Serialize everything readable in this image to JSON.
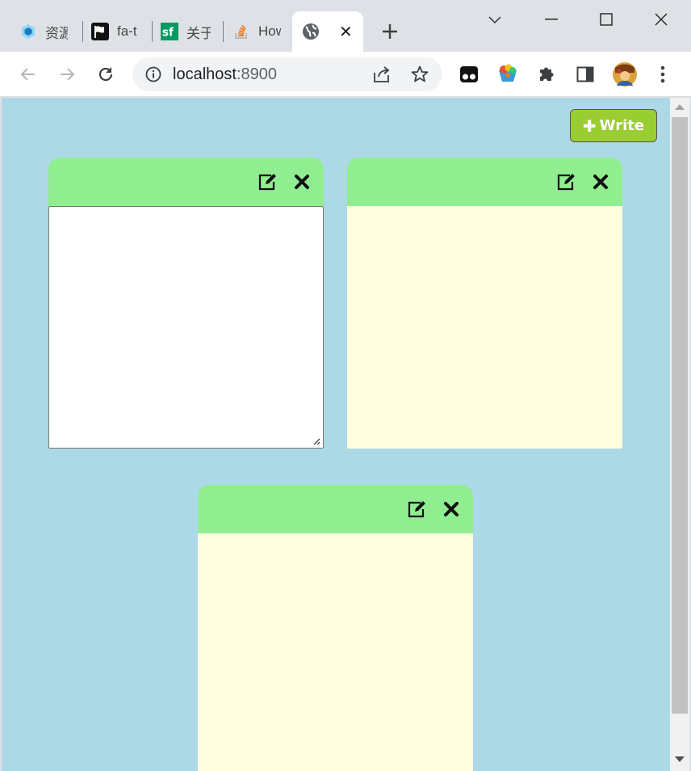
{
  "browser": {
    "tabs": [
      {
        "label": "资源",
        "icon": "webpack-cube-icon"
      },
      {
        "label": "fa-t",
        "icon": "flag-icon"
      },
      {
        "label": "关于",
        "icon": "sf-logo-icon"
      },
      {
        "label": "How",
        "icon": "stackoverflow-icon"
      },
      {
        "label": "",
        "icon": "globe-icon",
        "active": true
      }
    ],
    "address": {
      "host": "localhost",
      "port": ":8900"
    }
  },
  "page": {
    "write_button": {
      "label": "Write",
      "icon": "plus-icon",
      "color": "#9acd32"
    },
    "colors": {
      "background": "#add8e6",
      "note_header": "#90ee90",
      "note_body": "#ffffe0"
    },
    "notes": [
      {
        "mode": "editing",
        "content": ""
      },
      {
        "mode": "display",
        "content": ""
      },
      {
        "mode": "display",
        "content": ""
      }
    ]
  }
}
